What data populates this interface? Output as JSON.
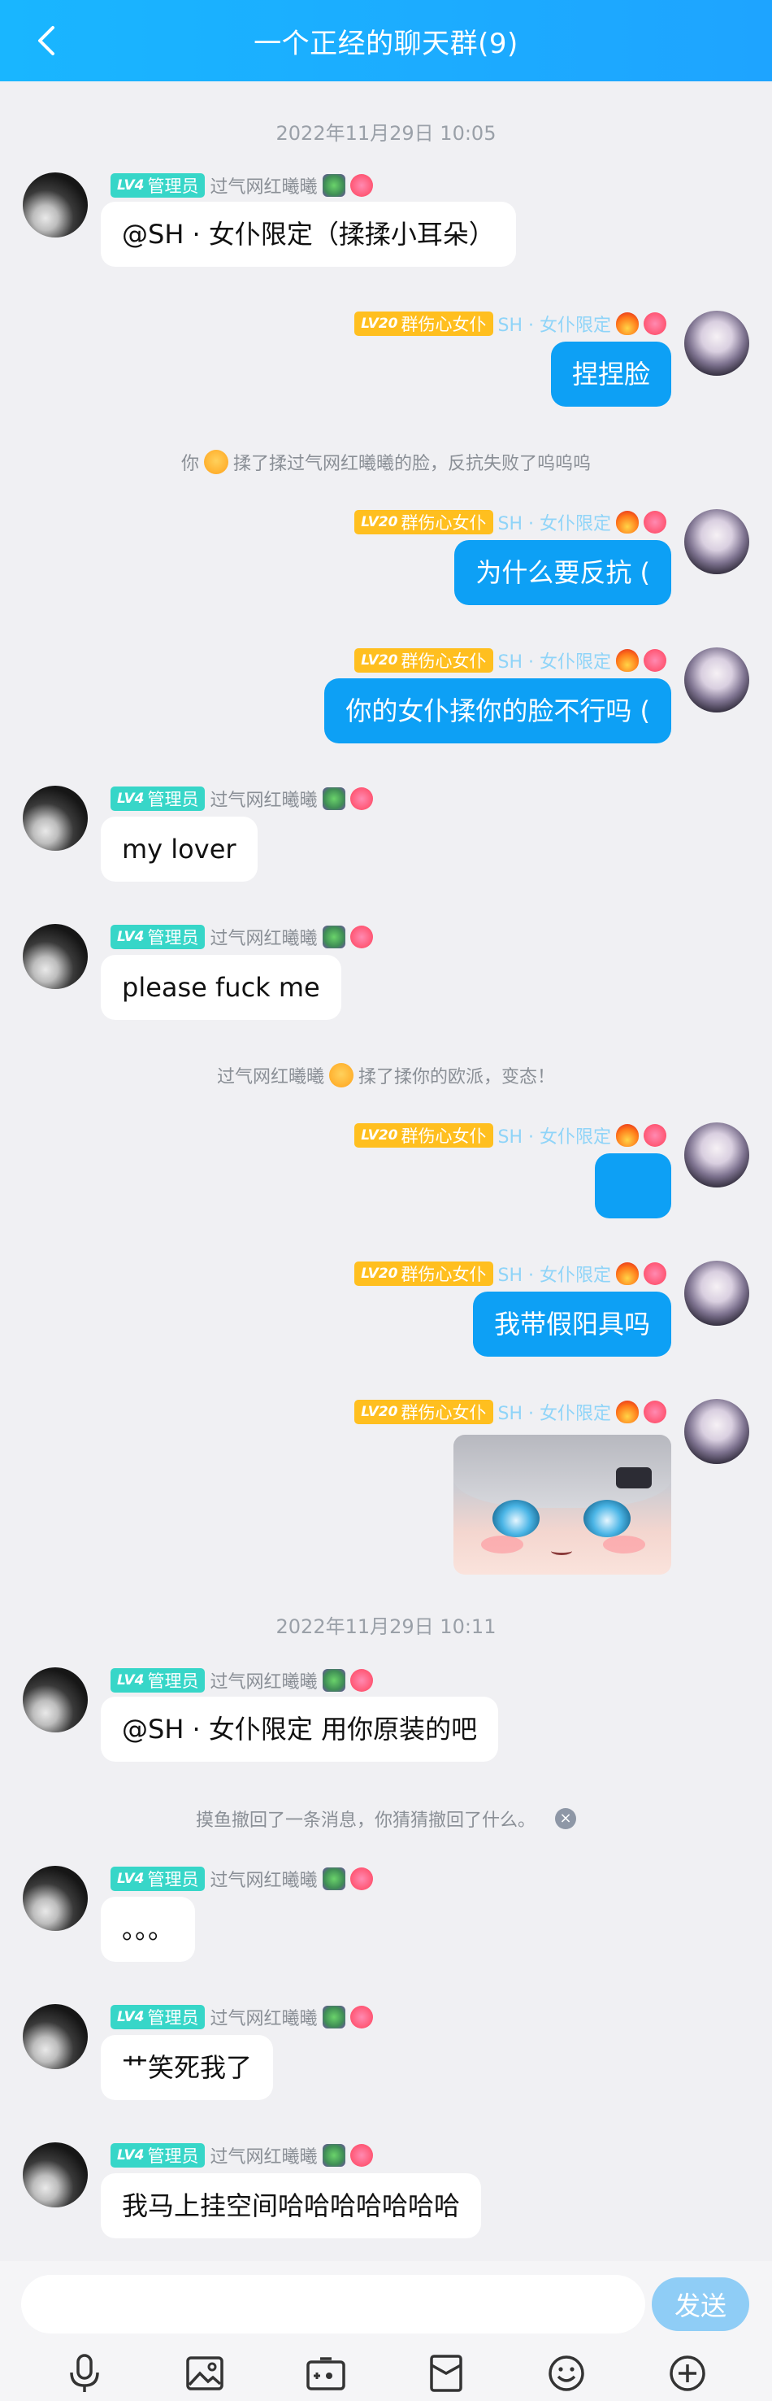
{
  "header": {
    "title": "一个正经的聊天群(9)"
  },
  "timestamps": [
    "2022年11月29日 10:05",
    "2022年11月29日 10:11"
  ],
  "users": {
    "other": {
      "badge_lv": "LV4",
      "badge_text": "管理员",
      "name": "过气网红曦曦"
    },
    "me": {
      "badge_lv": "LV20",
      "badge_text": "群伤心女仆",
      "name": "SH · 女仆限定"
    }
  },
  "messages": [
    {
      "text": "@SH · 女仆限定（揉揉小耳朵）"
    },
    {
      "text": "捏捏脸"
    },
    {
      "text": "为什么要反抗 ("
    },
    {
      "text": "你的女仆揉你的脸不行吗 ("
    },
    {
      "text": "my lover"
    },
    {
      "text": "please fuck me"
    },
    {
      "text": ""
    },
    {
      "text": "我带假阳具吗"
    },
    {
      "text": "@SH · 女仆限定 用你原装的吧"
    },
    {
      "text": "。。。"
    },
    {
      "text": "艹笑死我了"
    },
    {
      "text": "我马上挂空间哈哈哈哈哈哈哈"
    }
  ],
  "system_messages": {
    "s1_prefix": "你",
    "s1_suffix": "揉了揉过气网红曦曦的脸，反抗失败了呜呜呜",
    "s2_prefix": "过气网红曦曦",
    "s2_suffix": "揉了揉你的欧派，变态！",
    "s3": "摸鱼撤回了一条消息，你猜猜撤回了什么。"
  },
  "composer": {
    "placeholder": "",
    "send_label": "发送"
  },
  "toolbar": {
    "icons": [
      "microphone-icon",
      "image-icon",
      "camera-icon",
      "red-packet-icon",
      "emoji-icon",
      "plus-icon"
    ]
  },
  "colors": {
    "header": "#1ea4ff",
    "bubble_me": "#0da0f5",
    "badge_admin": "#37d6c8",
    "badge_group": "#ffbf1f",
    "send_button": "#8fcdf6"
  }
}
